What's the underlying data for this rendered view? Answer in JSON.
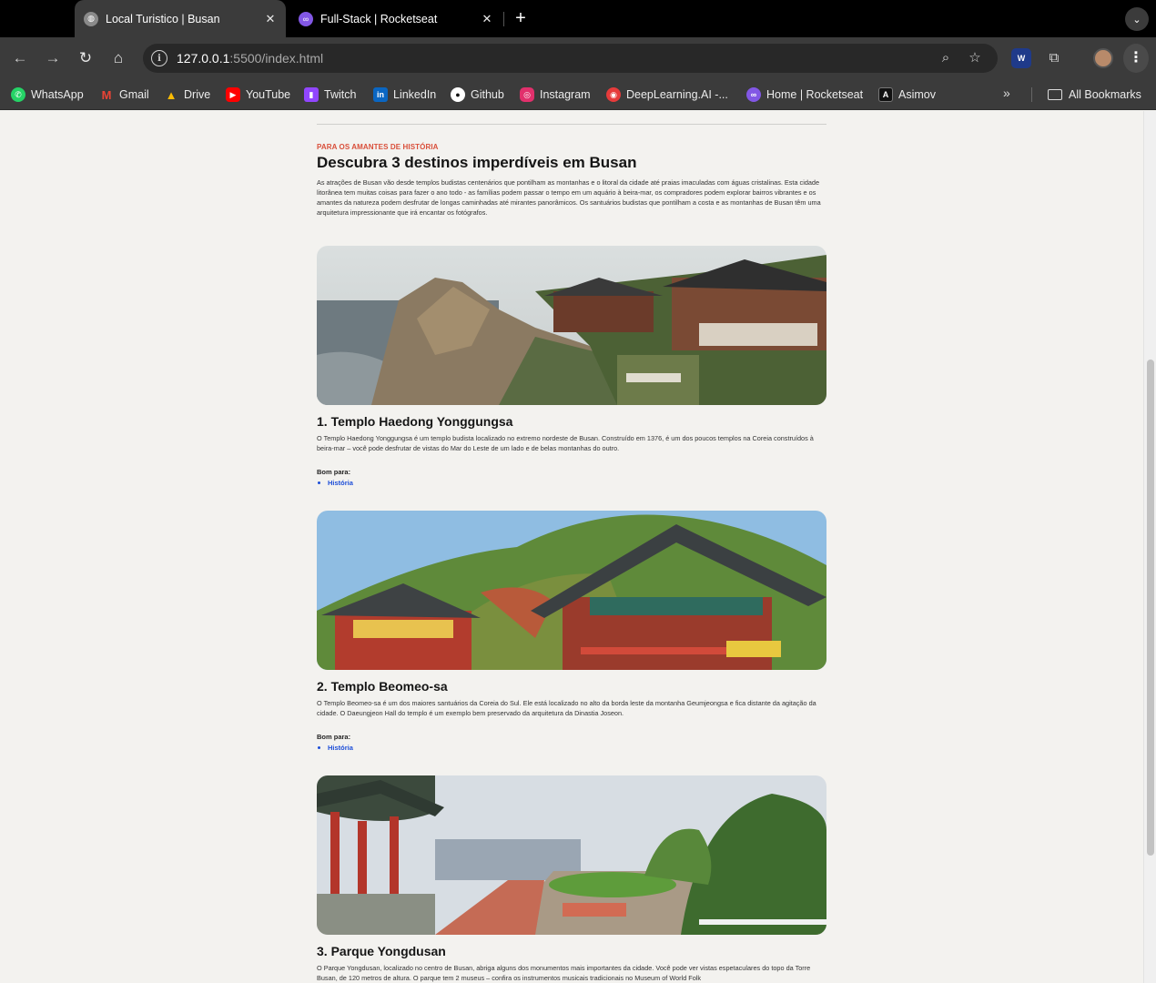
{
  "browser": {
    "tabs": [
      {
        "title": "Local Turistico | Busan",
        "favicon": "globe-icon",
        "active": true
      },
      {
        "title": "Full-Stack | Rocketseat",
        "favicon": "rocketseat-icon",
        "active": false
      }
    ],
    "url_host": "127.0.0.1",
    "url_path": ":5500/index.html",
    "bookmarks": [
      {
        "label": "WhatsApp",
        "icon": "whatsapp-icon",
        "color": "#25d366"
      },
      {
        "label": "Gmail",
        "icon": "gmail-icon",
        "color": "#ea4335"
      },
      {
        "label": "Drive",
        "icon": "drive-icon",
        "color": "#1fa463"
      },
      {
        "label": "YouTube",
        "icon": "youtube-icon",
        "color": "#ff0000"
      },
      {
        "label": "Twitch",
        "icon": "twitch-icon",
        "color": "#9146ff"
      },
      {
        "label": "LinkedIn",
        "icon": "linkedin-icon",
        "color": "#0a66c2"
      },
      {
        "label": "Github",
        "icon": "github-icon",
        "color": "#ffffff"
      },
      {
        "label": "Instagram",
        "icon": "instagram-icon",
        "color": "#e1306c"
      },
      {
        "label": "DeepLearning.AI -...",
        "icon": "deeplearning-icon",
        "color": "#e63b3b"
      },
      {
        "label": "Home | Rocketseat",
        "icon": "rocketseat-icon",
        "color": "#8257e5"
      },
      {
        "label": "Asimov",
        "icon": "asimov-icon",
        "color": "#111111"
      }
    ],
    "all_bookmarks_label": "All Bookmarks"
  },
  "page": {
    "eyebrow": "PARA OS AMANTES DE HISTÓRIA",
    "title": "Descubra 3 destinos imperdíveis em Busan",
    "intro": "As atrações de Busan vão desde templos budistas centenários que pontilham as montanhas e o litoral da cidade até praias imaculadas com águas cristalinas. Esta cidade litorânea tem muitas coisas para fazer o ano todo - as famílias podem passar o tempo em um aquário à beira-mar, os compradores podem explorar bairros vibrantes e os amantes da natureza podem desfrutar de longas caminhadas até mirantes panorâmicos. Os santuários budistas que pontilham a costa e as montanhas de Busan têm uma arquitetura impressionante que irá encantar os fotógrafos.",
    "good_for_label": "Bom para:",
    "destinations": [
      {
        "title": "1. Templo Haedong Yonggungsa",
        "description": "O Templo Haedong Yonggungsa é um templo budista localizado no extremo nordeste de Busan. Construído em 1376, é um dos poucos templos na Coreia construídos à beira-mar – você pode desfrutar de vistas do Mar do Leste de um lado e de belas montanhas do outro.",
        "tags": [
          "História"
        ]
      },
      {
        "title": "2. Templo Beomeo-sa",
        "description": "O Templo Beomeo-sa é um dos maiores santuários da Coreia do Sul. Ele está localizado no alto da borda leste da montanha Geumjeongsa e fica distante da agitação da cidade. O Daeungjeon Hall do templo é um exemplo bem preservado da arquitetura da Dinastia Joseon.",
        "tags": [
          "História"
        ]
      },
      {
        "title": "3. Parque Yongdusan",
        "description": "O Parque Yongdusan, localizado no centro de Busan, abriga alguns dos monumentos mais importantes da cidade. Você pode ver vistas espetaculares do topo da Torre Busan, de 120 metros de altura. O parque tem 2 museus – confira os instrumentos musicais tradicionais no Museum of World Folk",
        "tags": []
      }
    ]
  }
}
